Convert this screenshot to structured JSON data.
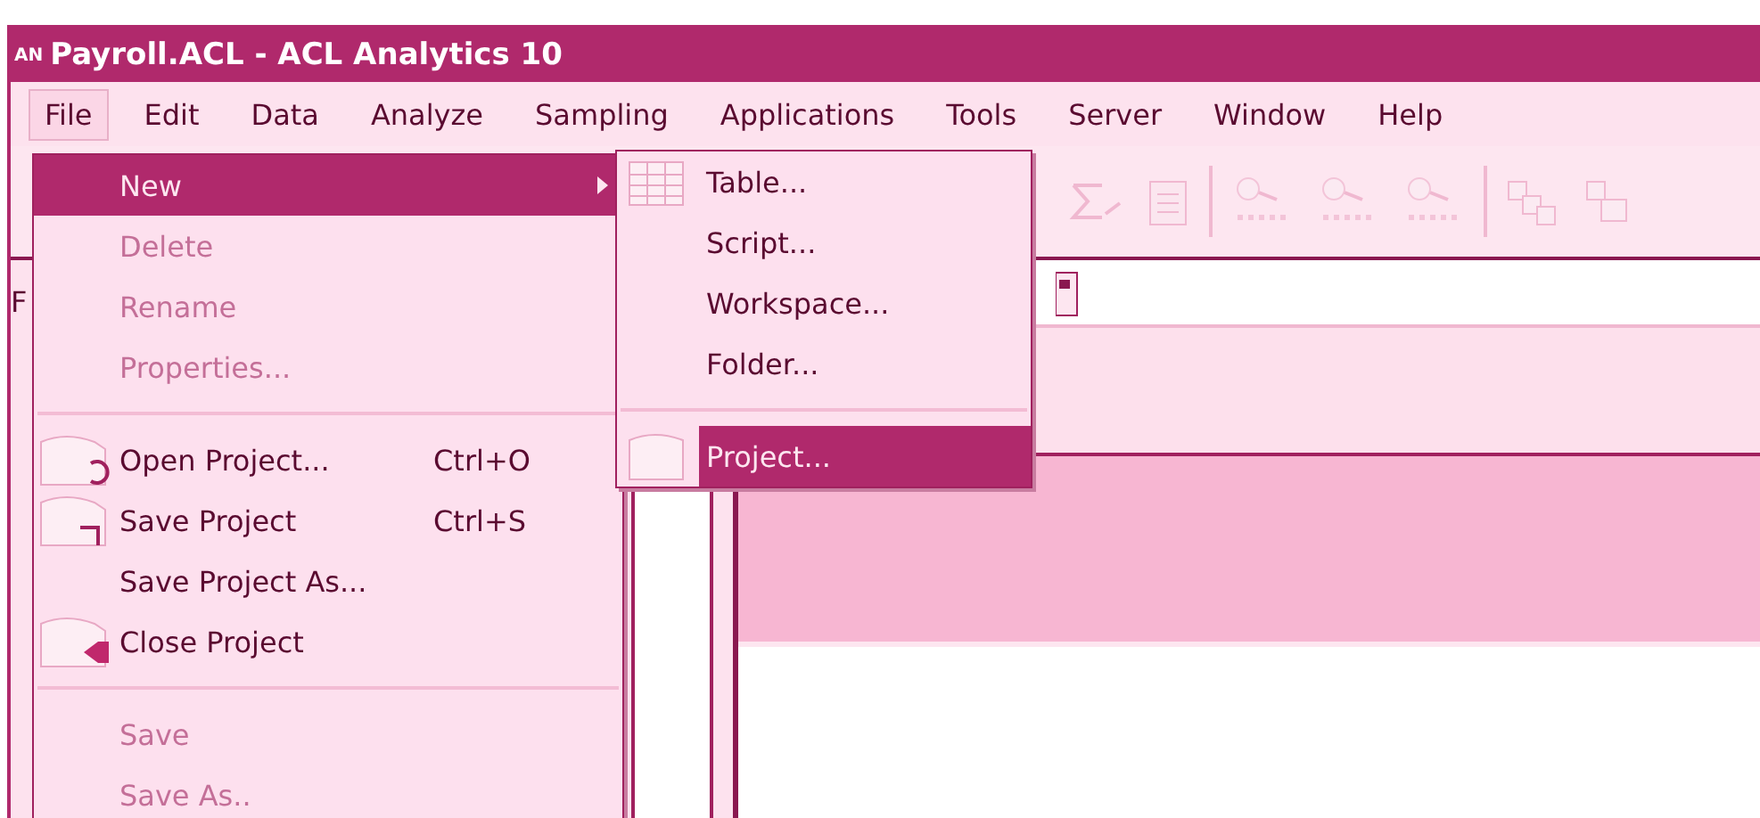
{
  "window": {
    "badge": "AN",
    "title": "Payroll.ACL - ACL Analytics 10"
  },
  "menu_bar": [
    {
      "label": "File",
      "selected": true
    },
    {
      "label": "Edit",
      "selected": false
    },
    {
      "label": "Data",
      "selected": false
    },
    {
      "label": "Analyze",
      "selected": false
    },
    {
      "label": "Sampling",
      "selected": false
    },
    {
      "label": "Applications",
      "selected": false
    },
    {
      "label": "Tools",
      "selected": false
    },
    {
      "label": "Server",
      "selected": false
    },
    {
      "label": "Window",
      "selected": false
    },
    {
      "label": "Help",
      "selected": false
    }
  ],
  "left_pane": {
    "label": "F"
  },
  "file_menu": [
    {
      "kind": "item",
      "label": "New",
      "selected": true,
      "disabled": false,
      "submenu": true
    },
    {
      "kind": "item",
      "label": "Delete",
      "selected": false,
      "disabled": true
    },
    {
      "kind": "item",
      "label": "Rename",
      "selected": false,
      "disabled": true
    },
    {
      "kind": "item",
      "label": "Properties...",
      "selected": false,
      "disabled": true
    },
    {
      "kind": "separator"
    },
    {
      "kind": "item",
      "label": "Open Project...",
      "shortcut": "Ctrl+O",
      "selected": false,
      "disabled": false
    },
    {
      "kind": "item",
      "label": "Save Project",
      "shortcut": "Ctrl+S",
      "selected": false,
      "disabled": false
    },
    {
      "kind": "item",
      "label": "Save Project As...",
      "selected": false,
      "disabled": false
    },
    {
      "kind": "item",
      "label": "Close Project",
      "selected": false,
      "disabled": false
    },
    {
      "kind": "separator"
    },
    {
      "kind": "item",
      "label": "Save",
      "selected": false,
      "disabled": true
    },
    {
      "kind": "item",
      "label": "Save As..",
      "selected": false,
      "disabled": true
    }
  ],
  "new_submenu": [
    {
      "kind": "item",
      "label": "Table...",
      "selected": false
    },
    {
      "kind": "item",
      "label": "Script...",
      "selected": false
    },
    {
      "kind": "item",
      "label": "Workspace...",
      "selected": false
    },
    {
      "kind": "item",
      "label": "Folder...",
      "selected": false
    },
    {
      "kind": "separator"
    },
    {
      "kind": "item",
      "label": "Project...",
      "selected": true
    }
  ]
}
